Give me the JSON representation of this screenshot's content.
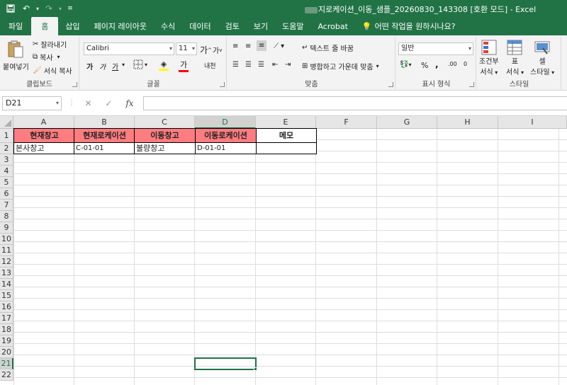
{
  "titlebar": {
    "title": "지로케이션_이동_샘플_20260830_143308  [호환 모드]  -  Excel",
    "save_icon": "save-icon",
    "undo_icon": "undo-icon",
    "redo_icon": "redo-icon"
  },
  "tabs": [
    "파일",
    "홈",
    "삽입",
    "페이지 레이아웃",
    "수식",
    "데이터",
    "검토",
    "보기",
    "도움말",
    "Acrobat"
  ],
  "active_tab": "홈",
  "tell_me": "어떤 작업을 원하시나요?",
  "ribbon": {
    "clipboard": {
      "paste": "붙여넣기",
      "cut": "잘라내기",
      "copy": "복사",
      "format_painter": "서식 복사",
      "label": "클립보드"
    },
    "font": {
      "name": "Calibri",
      "size": "11",
      "grow": "가",
      "shrink": "가",
      "bold": "가",
      "italic": "가",
      "underline": "가",
      "font_color_char": "가",
      "phonetic": "내천",
      "label": "글꼴"
    },
    "alignment": {
      "wrap_text": "텍스트 줄 바꿈",
      "merge_center": "병합하고 가운데 맞춤",
      "label": "맞춤"
    },
    "number": {
      "format": "일반",
      "percent": "%",
      "comma": ",",
      "inc_decimal": ".00",
      "dec_decimal": "0",
      "label": "표시 형식"
    },
    "styles": {
      "conditional": "조건부",
      "conditional2": "서식",
      "table": "표",
      "table2": "서식",
      "cell": "셀",
      "cell2": "스타일",
      "label": "스타일"
    }
  },
  "formula_bar": {
    "name_box": "D21",
    "cancel": "✕",
    "enter": "✓",
    "fx": "fx",
    "value": ""
  },
  "sheet": {
    "columns": [
      "A",
      "B",
      "C",
      "D",
      "E",
      "F",
      "G",
      "H",
      "I"
    ],
    "rows": [
      "1",
      "2",
      "3",
      "4",
      "5",
      "6",
      "7",
      "8",
      "9",
      "10",
      "11",
      "12",
      "13",
      "14",
      "15",
      "16",
      "17",
      "18",
      "19",
      "20",
      "21",
      "22"
    ],
    "header_row": [
      "현재창고",
      "현재로케이션",
      "이동창고",
      "이동로케이션",
      "메모"
    ],
    "data_row": [
      "본사창고",
      "C-01-01",
      "불량창고",
      "D-01-01",
      ""
    ],
    "selected_cell": "D21",
    "header_fill": "#ff7c80",
    "accent": "#217346"
  }
}
